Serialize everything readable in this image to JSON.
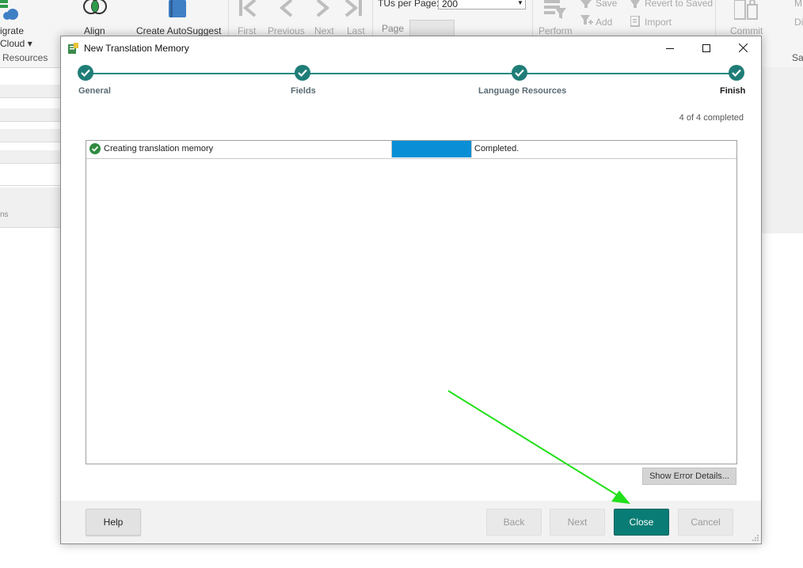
{
  "ribbon": {
    "migrate_line1": "igrate",
    "migrate_line2": "Cloud ▾",
    "resources_label": "Resources",
    "align_label": "Align",
    "autosuggest_label": "Create AutoSuggest",
    "nav": {
      "first": "First",
      "previous": "Previous",
      "next": "Next",
      "last": "Last"
    },
    "tus_per_page_label": "TUs per Page:",
    "tus_per_page_value": "200",
    "page_label": "Page",
    "perform_label": "Perform",
    "save_label": "Save",
    "add_label": "Add",
    "revert_label": "Revert to Saved",
    "import_label": "Import",
    "commit_label": "Commit",
    "right_m": "M",
    "right_di": "Di",
    "right_sav": "Sav",
    "left_ns": "ns"
  },
  "dialog": {
    "title": "New Translation Memory",
    "window_buttons": {
      "minimize": "—",
      "maximize": "☐",
      "close": "✕"
    },
    "steps": [
      {
        "label": "General",
        "done": true
      },
      {
        "label": "Fields",
        "done": true
      },
      {
        "label": "Language Resources",
        "done": true
      },
      {
        "label": "Finish",
        "done": true,
        "active": true
      }
    ],
    "progress_text": "4 of 4 completed",
    "tasks": [
      {
        "name": "Creating translation memory",
        "progress": 1.0,
        "status": "Completed."
      }
    ],
    "show_error_details_label": "Show Error Details...",
    "buttons": {
      "help": "Help",
      "back": "Back",
      "next": "Next",
      "close": "Close",
      "cancel": "Cancel"
    }
  },
  "colors": {
    "accent_teal": "#097d75",
    "progress_blue": "#0a8fd6",
    "annotation_arrow": "#22e01a"
  }
}
